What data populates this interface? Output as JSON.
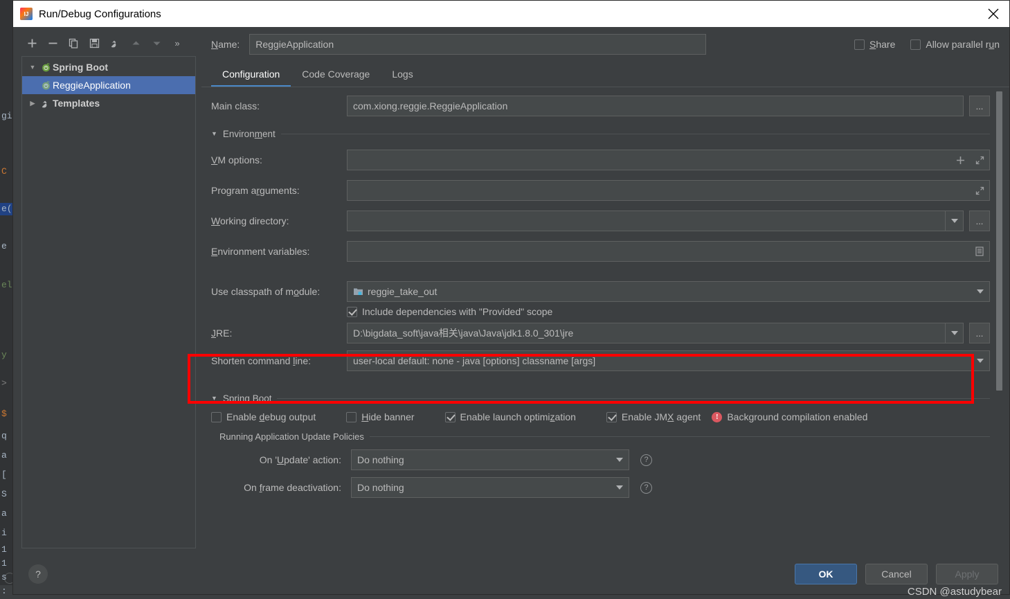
{
  "window": {
    "title": "Run/Debug Configurations",
    "logo_icon": "intellij-idea-logo",
    "close_icon": "close-icon"
  },
  "left_pane": {
    "toolbar": [
      {
        "name": "add-configuration-button",
        "icon": "plus-icon",
        "label": "+"
      },
      {
        "name": "remove-configuration-button",
        "icon": "minus-icon",
        "label": "−"
      },
      {
        "name": "copy-configuration-button",
        "icon": "copy-icon",
        "label": ""
      },
      {
        "name": "save-configuration-button",
        "icon": "save-icon",
        "label": ""
      },
      {
        "name": "edit-templates-button",
        "icon": "wrench-icon",
        "label": ""
      },
      {
        "name": "move-up-button",
        "icon": "arrow-up-icon",
        "label": ""
      },
      {
        "name": "move-down-button",
        "icon": "arrow-down-icon",
        "label": ""
      },
      {
        "name": "more-actions-button",
        "icon": "chevron-double-right-icon",
        "label": "»"
      }
    ],
    "tree": [
      {
        "label": "Spring Boot",
        "icon": "spring-boot-icon",
        "expanded": true,
        "type": "group",
        "selected": false
      },
      {
        "label": "ReggieApplication",
        "icon": "spring-boot-icon",
        "type": "child",
        "selected": true
      },
      {
        "label": "Templates",
        "icon": "wrench-icon",
        "expanded": false,
        "type": "group",
        "selected": false
      }
    ]
  },
  "header": {
    "name_label": "Name:",
    "name_value": "ReggieApplication",
    "share_label": "Share",
    "share_checked": false,
    "allow_parallel_label": "Allow parallel run",
    "allow_parallel_checked": false
  },
  "tabs": [
    {
      "label": "Configuration",
      "active": true
    },
    {
      "label": "Code Coverage",
      "active": false
    },
    {
      "label": "Logs",
      "active": false
    }
  ],
  "form": {
    "main_class_label": "Main class:",
    "main_class_value": "com.xiong.reggie.ReggieApplication",
    "browse_label": "...",
    "environment_section": "Environment",
    "vm_options_label": "VM options:",
    "vm_options_value": "",
    "program_arguments_label": "Program arguments:",
    "program_arguments_value": "",
    "working_directory_label": "Working directory:",
    "working_directory_value": "",
    "environment_variables_label": "Environment variables:",
    "environment_variables_value": "",
    "use_classpath_label": "Use classpath of module:",
    "use_classpath_value": "reggie_take_out",
    "include_dependencies_label": "Include dependencies with \"Provided\" scope",
    "include_dependencies_checked": true,
    "jre_label": "JRE:",
    "jre_value": "D:\\bigdata_soft\\java相关\\java\\Java\\jdk1.8.0_301\\jre",
    "shorten_cmd_label": "Shorten command line:",
    "shorten_cmd_value": "user-local default: none - java [options] classname [args]"
  },
  "spring_boot": {
    "section_label": "Spring Boot",
    "enable_debug_output_label": "Enable debug output",
    "enable_debug_output_checked": false,
    "hide_banner_label": "Hide banner",
    "hide_banner_checked": false,
    "enable_launch_optimization_label": "Enable launch optimization",
    "enable_launch_optimization_checked": true,
    "enable_jmx_agent_label": "Enable JMX agent",
    "enable_jmx_agent_checked": true,
    "background_warning_label": "Background compilation enabled",
    "warning_icon": "error-circle-icon",
    "update_policies_label": "Running Application Update Policies",
    "on_update_label": "On 'Update' action:",
    "on_update_value": "Do nothing",
    "on_frame_deactivation_label": "On frame deactivation:",
    "on_frame_deactivation_value": "Do nothing",
    "help_icon": "question-circle-icon"
  },
  "footer": {
    "help_label": "?",
    "ok_label": "OK",
    "cancel_label": "Cancel",
    "apply_label": "Apply",
    "apply_disabled": true
  },
  "annotation": {
    "highlight_color": "#ff0000"
  },
  "watermark": "CSDN @astudybear",
  "background_code": [
    "gi",
    "C",
    "e(",
    "e",
    "el",
    "y",
    ">",
    "$",
    "q",
    "a",
    "[",
    "S",
    "a",
    "i",
    "1",
    "1",
    "s",
    ":"
  ],
  "colors": {
    "dialog_bg": "#3c3f41",
    "field_bg": "#45494a",
    "accent": "#4a88c7",
    "selection": "#4b6eaf",
    "primary_button": "#365880",
    "warning": "#db5860",
    "text": "#bbbbbb"
  }
}
